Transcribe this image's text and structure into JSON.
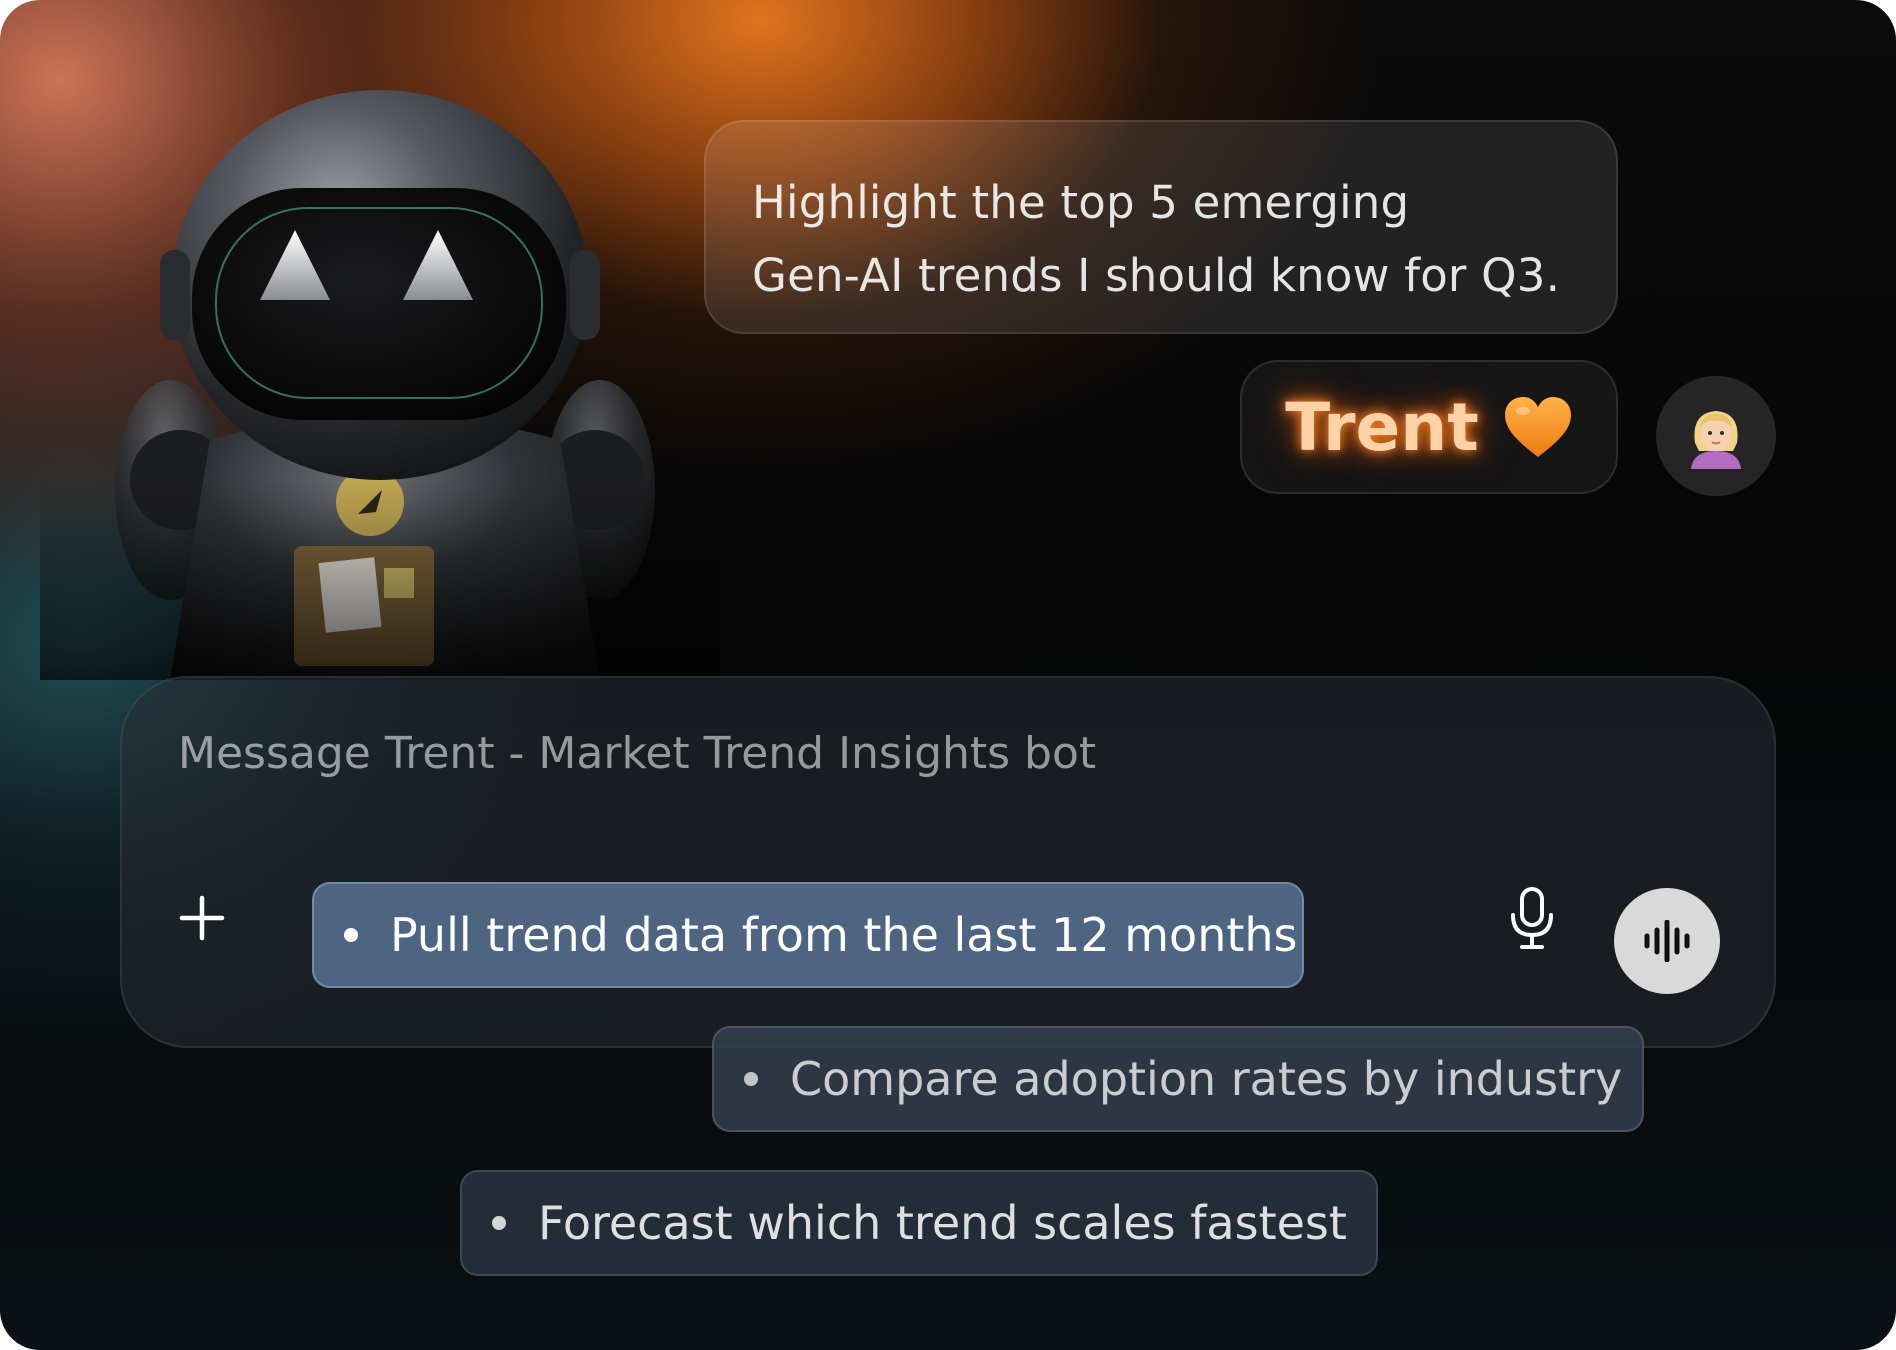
{
  "conversation": {
    "user_message_lines": [
      "Highlight the top 5 emerging",
      "Gen-AI trends I should know for Q3."
    ],
    "bot_name": "Trent",
    "bot_name_icon": "orange-heart-icon",
    "user_avatar_icon": "woman-avatar-icon"
  },
  "composer": {
    "placeholder": "Message Trent - Market Trend Insights bot",
    "value": "",
    "plus_icon": "plus-icon",
    "mic_icon": "microphone-icon",
    "voice_icon": "voice-waveform-icon"
  },
  "suggestions": [
    {
      "label": "Pull trend data from the last 12 months"
    },
    {
      "label": "Compare adoption rates by industry"
    },
    {
      "label": "Forecast which trend scales fastest"
    }
  ],
  "colors": {
    "accent_orange": "#ec7a1e",
    "chip_active": "#4d6580",
    "voice_button": "#d9d9d9"
  }
}
